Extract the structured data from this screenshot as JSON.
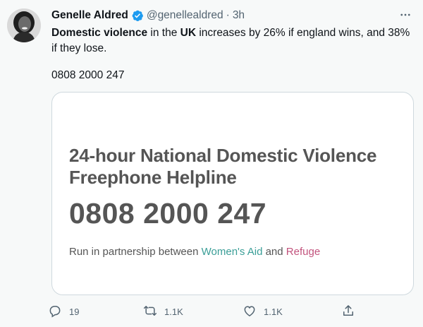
{
  "tweet": {
    "author_name": "Genelle Aldred",
    "handle": "@genellealdred",
    "separator": "·",
    "time": "3h",
    "text_parts": {
      "bold1": "Domestic violence",
      "mid": " in the ",
      "bold2": "UK",
      "rest": " increases by 26% if england wins, and 38% if they lose."
    },
    "phone_line": "0808 2000 247"
  },
  "card": {
    "title_line1": "24-hour National Domestic Violence",
    "title_line2": "Freephone Helpline",
    "number": "0808 2000 247",
    "sub_prefix": "Run in partnership between ",
    "sub_womens_aid": "Women's Aid",
    "sub_and": " and ",
    "sub_refuge": "Refuge"
  },
  "actions": {
    "reply_count": "19",
    "retweet_count": "1.1K",
    "like_count": "1.1K"
  },
  "icons": {
    "verified": "verified-badge-icon",
    "more": "more-dots-icon",
    "reply": "reply-icon",
    "retweet": "retweet-icon",
    "like": "heart-icon",
    "share": "share-icon"
  },
  "colors": {
    "verified": "#1d9bf0",
    "muted": "#536471",
    "womens_aid": "#3a9e97",
    "refuge": "#c2537d"
  }
}
